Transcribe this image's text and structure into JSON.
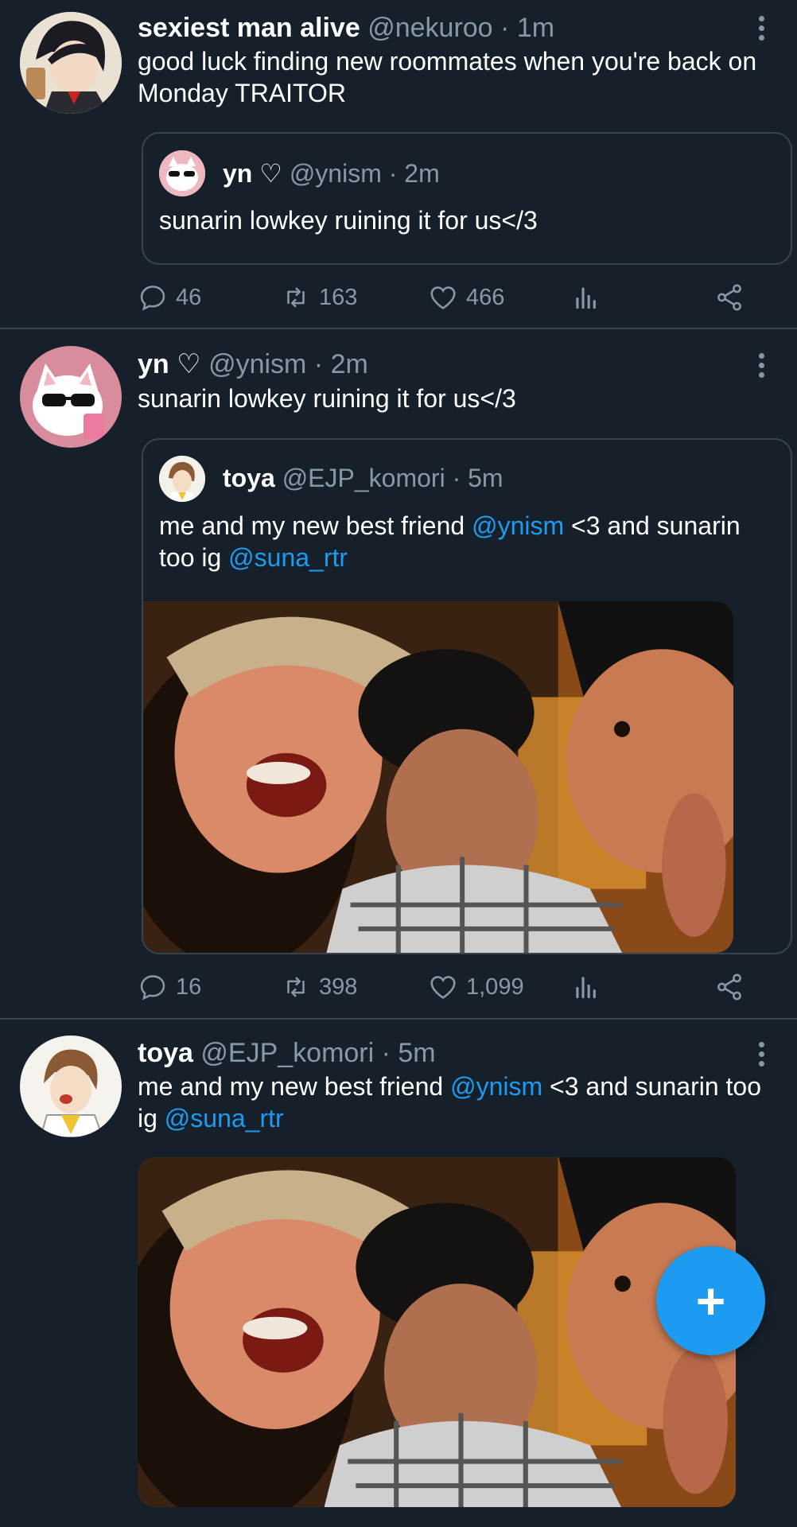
{
  "tweets": [
    {
      "name": "sexiest man alive",
      "handle": "@nekuroo",
      "time": "· 1m",
      "text": "good luck finding new roommates when you're back on Monday TRAITOR",
      "quote": {
        "name": "yn ♡",
        "handle": "@ynism",
        "time": "· 2m",
        "text": "sunarin lowkey ruining it for us</3"
      },
      "replies": "46",
      "retweets": "163",
      "likes": "466"
    },
    {
      "name": "yn ♡",
      "handle": "@ynism",
      "time": "· 2m",
      "text": "sunarin lowkey ruining it for us</3",
      "quote": {
        "name": "toya",
        "handle": "@EJP_komori",
        "time": "· 5m",
        "text_a": "me and my new best friend ",
        "mention_a": "@ynism",
        "text_b": " <3 and sunarin too ig ",
        "mention_b": "@suna_rtr"
      },
      "replies": "16",
      "retweets": "398",
      "likes": "1,099"
    },
    {
      "name": "toya",
      "handle": "@EJP_komori",
      "time": "· 5m",
      "text_a": "me and my new best friend ",
      "mention_a": "@ynism",
      "text_b": " <3 and sunarin too ig ",
      "mention_b": "@suna_rtr"
    }
  ],
  "fab_label": "+",
  "colors": {
    "background": "#15202b",
    "accent": "#1d9bf0",
    "muted": "#8899a6",
    "border": "#38444d"
  }
}
